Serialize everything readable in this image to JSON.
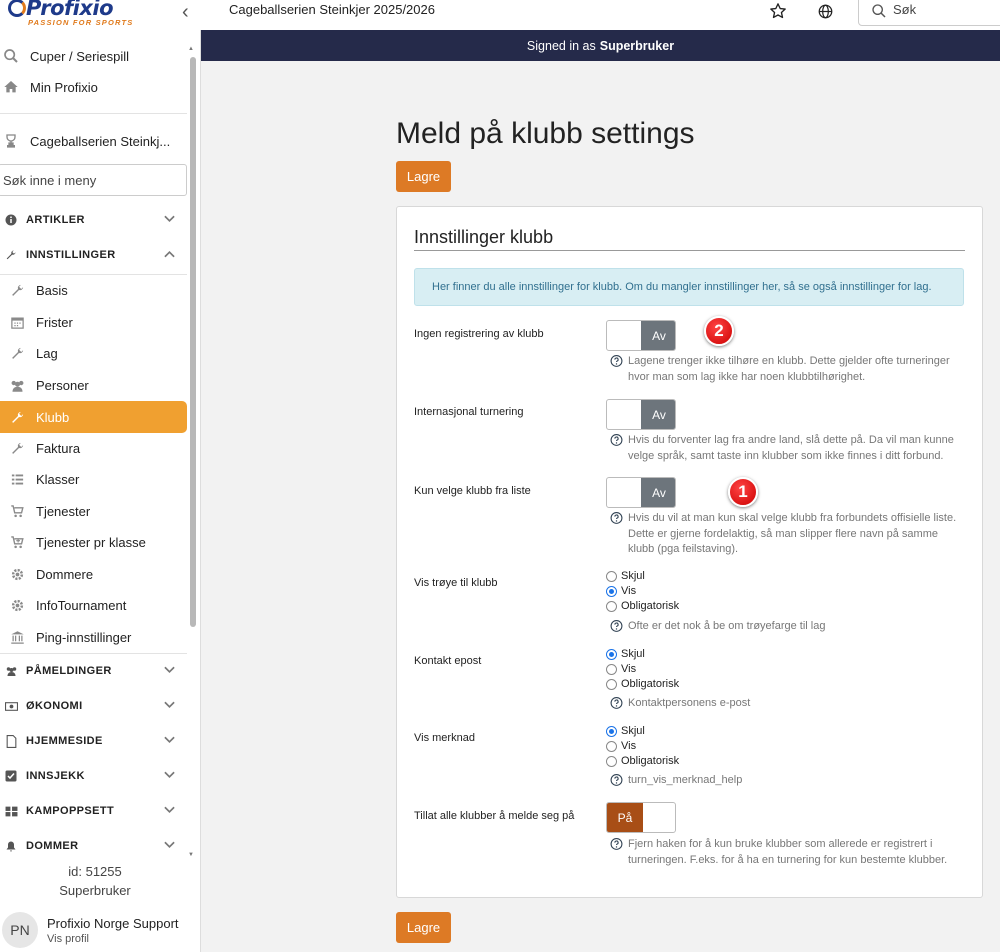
{
  "brand": {
    "name": "Profixio",
    "tagline": "PASSION FOR SPORTS"
  },
  "topbar": {
    "context_title": "Cageballserien Steinkjer 2025/2026",
    "search_placeholder": "Søk",
    "icons": [
      "back-chevron-icon",
      "star-icon",
      "globe-icon",
      "search-icon"
    ]
  },
  "banner": {
    "prefix": "Signed in as",
    "user": "Superbruker"
  },
  "sidebar": {
    "top_items": [
      {
        "label": "Cuper / Seriespill",
        "icon": "search-icon"
      },
      {
        "label": "Min Profixio",
        "icon": "home-icon"
      },
      {
        "label": "Cageballserien Steinkj...",
        "icon": "trophy-icon"
      }
    ],
    "menu_search_placeholder": "Søk inne i meny",
    "sections": {
      "artikler": "ARTIKLER",
      "innstillinger": "INNSTILLINGER",
      "pameldinger": "PÅMELDINGER",
      "okonomi": "ØKONOMI",
      "hjemmeside": "HJEMMESIDE",
      "innsjekk": "INNSJEKK",
      "kampoppsett": "KAMPOPPSETT",
      "dommer": "DOMMER"
    },
    "settings_items": [
      {
        "label": "Basis",
        "icon": "wrench-icon"
      },
      {
        "label": "Frister",
        "icon": "calendar-icon"
      },
      {
        "label": "Lag",
        "icon": "wrench-icon"
      },
      {
        "label": "Personer",
        "icon": "users-icon"
      },
      {
        "label": "Klubb",
        "icon": "wrench-icon",
        "active": true
      },
      {
        "label": "Faktura",
        "icon": "wrench-icon"
      },
      {
        "label": "Klasser",
        "icon": "list-icon"
      },
      {
        "label": "Tjenester",
        "icon": "cart-icon"
      },
      {
        "label": "Tjenester pr klasse",
        "icon": "cart-plus-icon"
      },
      {
        "label": "Dommere",
        "icon": "gear-icon"
      },
      {
        "label": "InfoTournament",
        "icon": "gear-icon"
      },
      {
        "label": "Ping-innstillinger",
        "icon": "bank-icon"
      }
    ],
    "footer": {
      "id_text": "id: 51255",
      "role": "Superbruker"
    },
    "profile": {
      "initials": "PN",
      "name": "Profixio Norge Support",
      "link": "Vis profil"
    }
  },
  "main": {
    "title": "Meld på klubb settings",
    "save_label": "Lagre",
    "card": {
      "title": "Innstillinger klubb",
      "info": "Her finner du alle innstillinger for klubb. Om du mangler innstillinger her, så se også innstillinger for lag.",
      "settings": {
        "ingen_reg": {
          "label": "Ingen registrering av klubb",
          "toggle": "Av",
          "help": "Lagene trenger ikke tilhøre en klubb. Dette gjelder ofte turneringer hvor man som lag ikke har noen klubbtilhørighet."
        },
        "internasjonal": {
          "label": "Internasjonal turnering",
          "toggle": "Av",
          "help": "Hvis du forventer lag fra andre land, slå dette på. Da vil man kunne velge språk, samt taste inn klubber som ikke finnes i ditt forbund."
        },
        "kun_liste": {
          "label": "Kun velge klubb fra liste",
          "toggle": "Av",
          "help": "Hvis du vil at man kun skal velge klubb fra forbundets offisielle liste. Dette er gjerne fordelaktig, så man slipper flere navn på samme klubb (pga feilstaving)."
        },
        "vis_troye": {
          "label": "Vis trøye til klubb",
          "options": [
            "Skjul",
            "Vis",
            "Obligatorisk"
          ],
          "selected": "Vis",
          "help": "Ofte er det nok å be om trøyefarge til lag"
        },
        "kontakt_epost": {
          "label": "Kontakt epost",
          "options": [
            "Skjul",
            "Vis",
            "Obligatorisk"
          ],
          "selected": "Skjul",
          "help": "Kontaktpersonens e-post"
        },
        "vis_merknad": {
          "label": "Vis merknad",
          "options": [
            "Skjul",
            "Vis",
            "Obligatorisk"
          ],
          "selected": "Skjul",
          "help": "turn_vis_merknad_help"
        },
        "tillat_alle": {
          "label": "Tillat alle klubber å melde seg på",
          "toggle": "På",
          "help": "Fjern haken for å kun bruke klubber som allerede er registrert i turneringen. F.eks. for å ha en turnering for kun bestemte klubber."
        }
      }
    },
    "annotations": {
      "badge_1": "1",
      "badge_2": "2"
    }
  },
  "colors": {
    "accent_orange": "#dd7a25",
    "active_menu": "#f0a030",
    "banner_bg": "#252a4a",
    "toggle_off": "#6d757c",
    "toggle_on": "#a84e16",
    "info_bg": "#d8eef3"
  }
}
